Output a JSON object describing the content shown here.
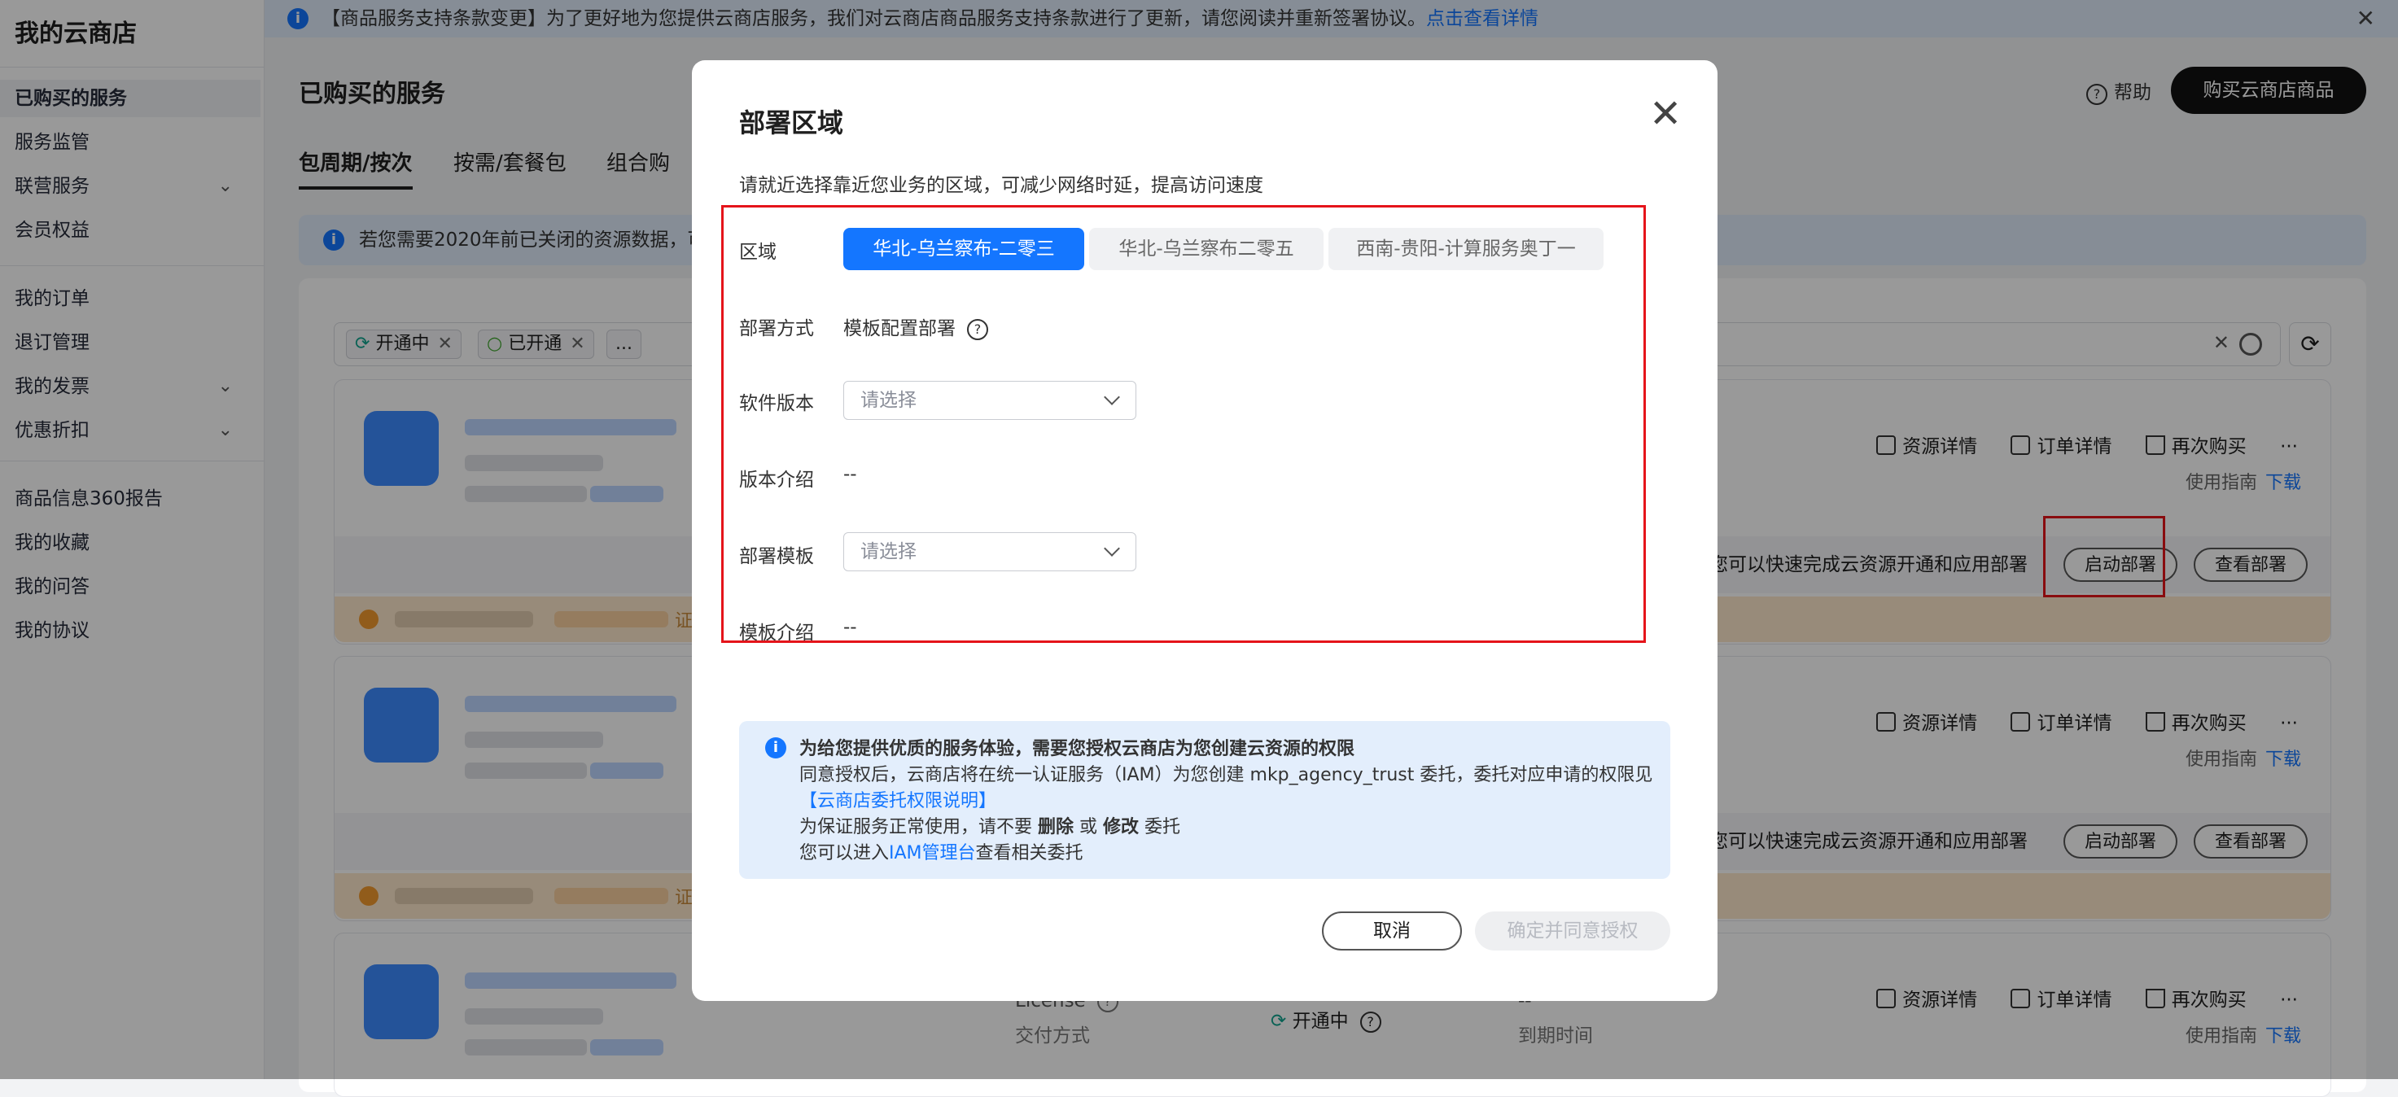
{
  "sidebar": {
    "title": "我的云商店",
    "items": [
      {
        "label": "已购买的服务"
      },
      {
        "label": "服务监管"
      },
      {
        "label": "联营服务"
      },
      {
        "label": "会员权益"
      },
      {
        "label": "我的订单"
      },
      {
        "label": "退订管理"
      },
      {
        "label": "我的发票"
      },
      {
        "label": "优惠折扣"
      },
      {
        "label": "商品信息360报告"
      },
      {
        "label": "我的收藏"
      },
      {
        "label": "我的问答"
      },
      {
        "label": "我的协议"
      }
    ],
    "chevron": "⌄"
  },
  "notice": {
    "text": "【商品服务支持条款变更】为了更好地为您提供云商店服务，我们对云商店商品服务支持条款进行了更新，请您阅读并重新签署协议。",
    "link": "点击查看详情",
    "close": "✕"
  },
  "header": {
    "title": "已购买的服务",
    "help": "帮助",
    "buy_button": "购买云商店商品"
  },
  "tabs": [
    {
      "label": "包周期/按次"
    },
    {
      "label": "按需/套餐包"
    },
    {
      "label": "组合购"
    }
  ],
  "info_banner": {
    "text": "若您需要2020年前已关闭的资源数据，可邮"
  },
  "filter": {
    "chips": [
      {
        "label": "开通中"
      },
      {
        "label": "已开通"
      },
      {
        "label": "..."
      }
    ]
  },
  "cards": {
    "ops": {
      "resource": "资源详情",
      "order": "订单详情",
      "rebuy": "再次购买",
      "more": "···"
    },
    "guide": "使用指南",
    "download": "下载",
    "deploy_text": "您可以快速完成云资源开通和应用部署",
    "start_deploy": "启动部署",
    "view_deploy": "查看部署",
    "warn_text": "证",
    "card3": {
      "license": "License",
      "delivery": "交付方式",
      "status": "开通中",
      "dash": "--",
      "expire": "到期时间"
    }
  },
  "modal": {
    "title": "部署区域",
    "close": "✕",
    "subtitle": "请就近选择靠近您业务的区域，可减少网络时延，提高访问速度",
    "region_label": "区域",
    "regions": [
      {
        "label": "华北-乌兰察布-二零三"
      },
      {
        "label": "华北-乌兰察布二零五"
      },
      {
        "label": "西南-贵阳-计算服务奥丁一"
      }
    ],
    "deploy_method_label": "部署方式",
    "deploy_method_value": "模板配置部署",
    "software_version_label": "软件版本",
    "select_placeholder": "请选择",
    "version_intro_label": "版本介绍",
    "version_intro_value": "--",
    "template_label": "部署模板",
    "template_intro_label": "模板介绍",
    "template_intro_value": "--",
    "auth": {
      "title": "为给您提供优质的服务体验，需要您授权云商店为您创建云资源的权限",
      "line1": "同意授权后，云商店将在统一认证服务（IAM）为您创建 mkp_agency_trust 委托，委托对应申请的权限见",
      "link1": "【云商店委托权限说明】",
      "line3_pre": "为保证服务正常使用，请不要 ",
      "line3_b1": "删除",
      "line3_mid": " 或 ",
      "line3_b2": "修改",
      "line3_post": " 委托",
      "line4_pre": "您可以进入",
      "line4_link": "IAM管理台",
      "line4_post": "查看相关委托"
    },
    "cancel": "取消",
    "confirm": "确定并同意授权"
  },
  "colors": {
    "accent": "#1476ff",
    "highlight": "#e5141a",
    "info_bg": "#e3eefc"
  }
}
